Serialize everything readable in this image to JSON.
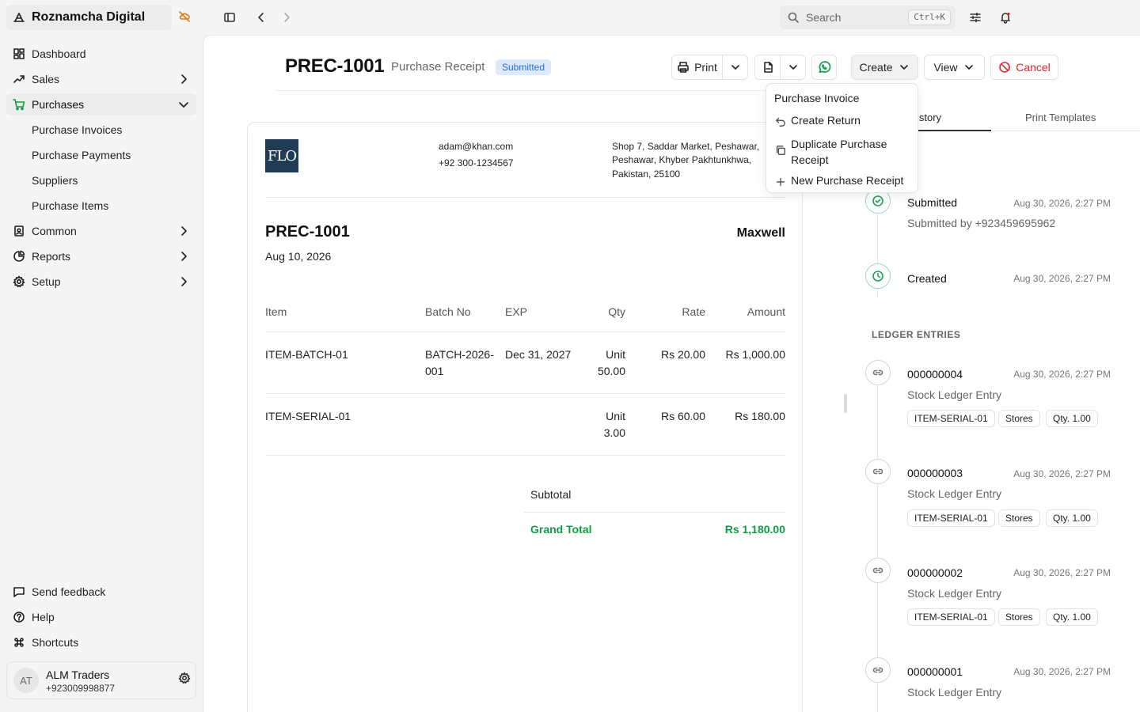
{
  "app": {
    "name": "Roznamcha Digital"
  },
  "sidebar": {
    "items": [
      {
        "label": "Dashboard",
        "icon": "dashboard-icon"
      },
      {
        "label": "Sales",
        "icon": "trending-up-icon"
      },
      {
        "label": "Purchases",
        "icon": "cart-icon"
      },
      {
        "label": "Common",
        "icon": "book-icon"
      },
      {
        "label": "Reports",
        "icon": "pie-chart-icon"
      },
      {
        "label": "Setup",
        "icon": "gear-icon"
      }
    ],
    "purchases_sub": [
      "Purchase Invoices",
      "Purchase Payments",
      "Suppliers",
      "Purchase Items"
    ],
    "footer": [
      {
        "label": "Send feedback",
        "icon": "message-icon"
      },
      {
        "label": "Help",
        "icon": "help-icon"
      },
      {
        "label": "Shortcuts",
        "icon": "command-icon"
      }
    ],
    "user": {
      "initials": "AT",
      "name": "ALM Traders",
      "phone": "+923009998877"
    }
  },
  "topbar": {
    "search_placeholder": "Search",
    "search_shortcut": "Ctrl+K"
  },
  "header": {
    "doc_id": "PREC-1001",
    "doc_type": "Purchase Receipt",
    "status": "Submitted",
    "buttons": {
      "print": "Print",
      "create": "Create",
      "view": "View",
      "cancel": "Cancel"
    }
  },
  "create_menu": {
    "items": [
      "Purchase Invoice",
      "Create Return",
      "Duplicate Purchase Receipt",
      "New Purchase Receipt"
    ]
  },
  "document": {
    "logo_text": "FLO",
    "email": "adam@khan.com",
    "phone": "+92 300-1234567",
    "address_lines": [
      "Shop 7, Saddar Market, Peshawar,",
      "Peshawar, Khyber Pakhtunkhwa,",
      "Pakistan, 25100"
    ],
    "number": "PREC-1001",
    "date": "Aug 10, 2026",
    "party": "Maxwell",
    "columns": [
      "Item",
      "Batch No",
      "EXP",
      "Qty",
      "Rate",
      "Amount"
    ],
    "rows": [
      {
        "item": "ITEM-BATCH-01",
        "batch_1": "BATCH-2026-",
        "batch_2": "001",
        "exp": "Dec 31, 2027",
        "qty_1": "Unit",
        "qty_2": "50.00",
        "rate": "Rs 20.00",
        "amount": "Rs 1,000.00"
      },
      {
        "item": "ITEM-SERIAL-01",
        "batch_1": "",
        "batch_2": "",
        "exp": "",
        "qty_1": "Unit",
        "qty_2": "3.00",
        "rate": "Rs 60.00",
        "amount": "Rs 180.00"
      }
    ],
    "subtotal_label": "Subtotal",
    "grand_total_label": "Grand Total",
    "grand_total": "Rs 1,180.00"
  },
  "right_panel": {
    "tabs": [
      "istory",
      "Print Templates"
    ],
    "history": [
      {
        "title": "Submitted",
        "sub": "Submitted by +923459695962",
        "time": "Aug 30, 2026, 2:27 PM"
      },
      {
        "title": "Created",
        "time": "Aug 30, 2026, 2:27 PM"
      }
    ],
    "ledger_header": "LEDGER ENTRIES",
    "ledger": [
      {
        "id": "000000004",
        "type": "Stock Ledger Entry",
        "time": "Aug 30, 2026, 2:27 PM",
        "chips": [
          "ITEM-SERIAL-01",
          "Stores",
          "Qty. 1.00"
        ]
      },
      {
        "id": "000000003",
        "type": "Stock Ledger Entry",
        "time": "Aug 30, 2026, 2:27 PM",
        "chips": [
          "ITEM-SERIAL-01",
          "Stores",
          "Qty. 1.00"
        ]
      },
      {
        "id": "000000002",
        "type": "Stock Ledger Entry",
        "time": "Aug 30, 2026, 2:27 PM",
        "chips": [
          "ITEM-SERIAL-01",
          "Stores",
          "Qty. 1.00"
        ]
      },
      {
        "id": "000000001",
        "type": "Stock Ledger Entry",
        "time": "Aug 30, 2026, 2:27 PM"
      }
    ]
  }
}
